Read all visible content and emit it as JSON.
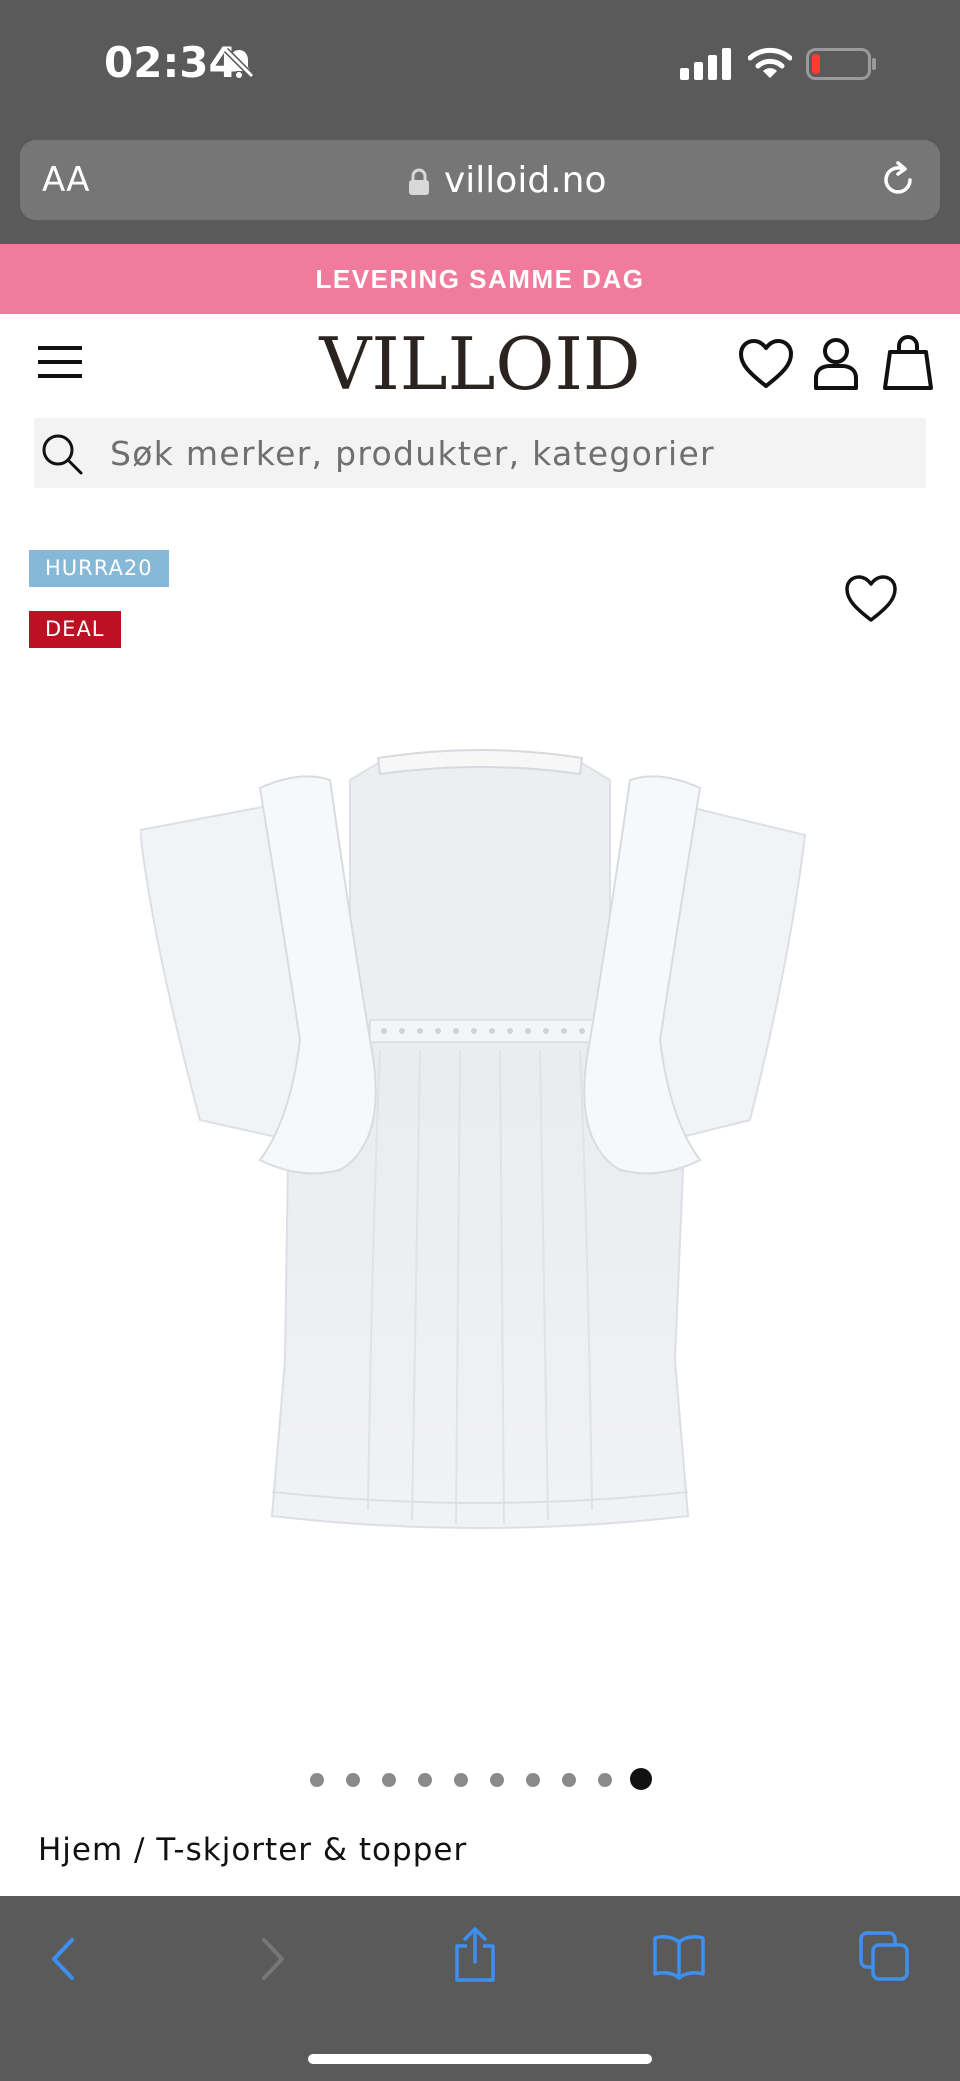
{
  "status_bar": {
    "time": "02:34"
  },
  "browser": {
    "aa_label": "AA",
    "url": "villoid.no"
  },
  "promo": {
    "text": "LEVERING SAMME DAG"
  },
  "header": {
    "logo": "VILLOID"
  },
  "search": {
    "placeholder": "Søk merker, produkter, kategorier"
  },
  "badges": {
    "code": "HURRA20",
    "deal": "DEAL"
  },
  "carousel": {
    "total": 10,
    "active_index": 9
  },
  "breadcrumb": {
    "text": "Hjem / T-skjorter & topper"
  },
  "colors": {
    "promo": "#f17b9c",
    "deal": "#bd1022",
    "code_badge": "#86b8d8",
    "browser_chrome": "#5a5a5a",
    "toolbar_accent": "#3d8ff0"
  }
}
